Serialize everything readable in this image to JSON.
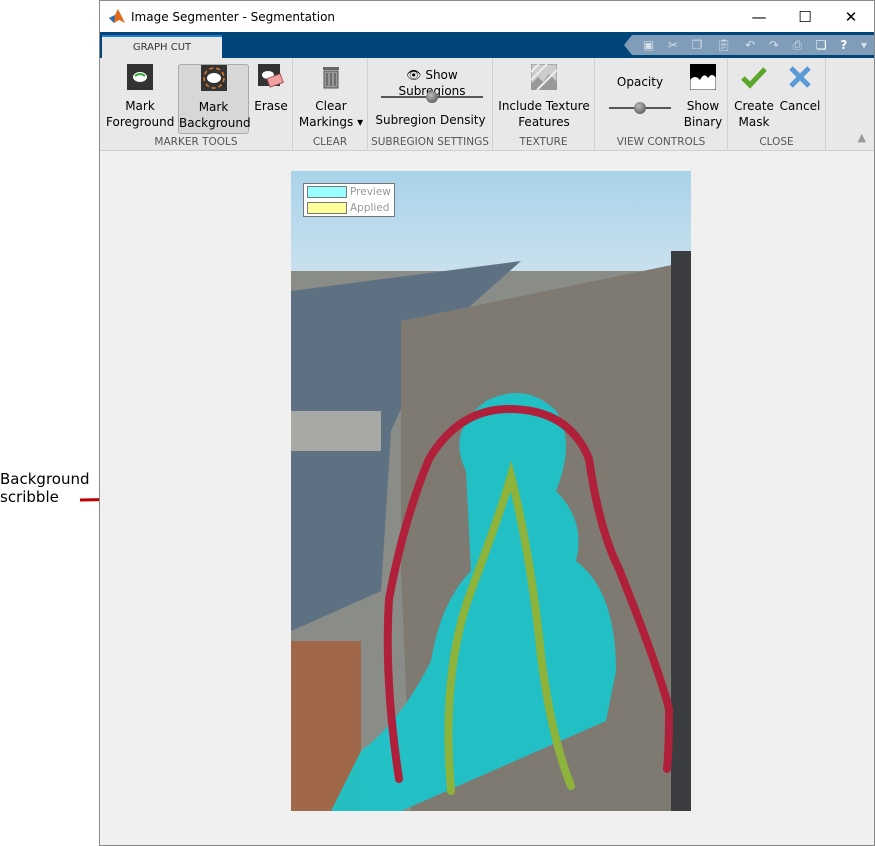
{
  "window": {
    "title": "Image Segmenter - Segmentation",
    "controls": [
      "minimize",
      "maximize",
      "close"
    ]
  },
  "tab": {
    "label": "GRAPH CUT"
  },
  "quick_access": [
    "save-icon",
    "cut-icon",
    "copy-icon",
    "paste-icon",
    "undo-icon",
    "redo-icon",
    "print-icon",
    "window-icon",
    "help-icon",
    "dropdown-icon"
  ],
  "ribbon": {
    "marker_tools": {
      "label": "MARKER TOOLS",
      "mark_foreground": [
        "Mark",
        "Foreground"
      ],
      "mark_background": [
        "Mark",
        "Background"
      ],
      "erase": "Erase",
      "selected": "Mark Background"
    },
    "clear": {
      "label": "CLEAR",
      "clear_markings": [
        "Clear",
        "Markings"
      ]
    },
    "subregion": {
      "label": "SUBREGION SETTINGS",
      "show_subregions": "Show Subregions",
      "density_label": "Subregion Density",
      "density_value": 0.5
    },
    "texture": {
      "label": "TEXTURE",
      "include_texture": [
        "Include Texture",
        "Features"
      ]
    },
    "view": {
      "label": "VIEW CONTROLS",
      "opacity_label": "Opacity",
      "opacity_value": 0.5,
      "show_binary": [
        "Show",
        "Binary"
      ]
    },
    "close": {
      "label": "CLOSE",
      "create_mask": [
        "Create",
        "Mask"
      ],
      "cancel": "Cancel"
    }
  },
  "legend": {
    "preview": "Preview",
    "applied": "Applied",
    "preview_color": "#99ffff",
    "applied_color": "#ffff99"
  },
  "colors": {
    "foreground_scribble": "#8db33a",
    "background_scribble": "#b0203a",
    "mask_overlay": "#1ec3c8"
  },
  "annotation": {
    "line1": "Background",
    "line2": "scribble"
  }
}
